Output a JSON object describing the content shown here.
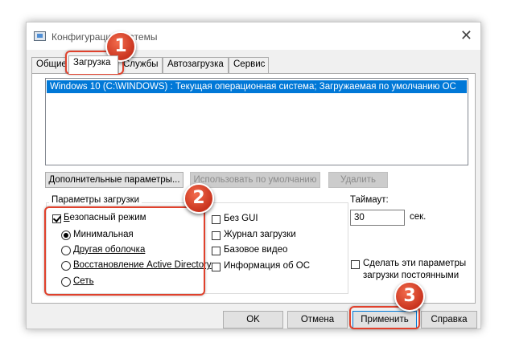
{
  "window": {
    "title": "Конфигурация системы",
    "close_symbol": "✕"
  },
  "tabs": [
    {
      "label": "Общие"
    },
    {
      "label": "Загрузка",
      "active": true
    },
    {
      "label": "Службы"
    },
    {
      "label": "Автозагрузка"
    },
    {
      "label": "Сервис"
    }
  ],
  "boot_list": {
    "items": [
      "Windows 10 (C:\\WINDOWS) : Текущая операционная система; Загружаемая по умолчанию ОС"
    ]
  },
  "buttons": {
    "advanced": "Дополнительные параметры...",
    "set_default": "Использовать по умолчанию",
    "delete": "Удалить"
  },
  "boot_options": {
    "group_title": "Параметры загрузки",
    "safe_boot": {
      "label": "Безопасный режим",
      "checked": true
    },
    "radios": [
      {
        "label": "Минимальная",
        "selected": true
      },
      {
        "label": "Другая оболочка",
        "selected": false
      },
      {
        "label": "Восстановление Active Directory",
        "selected": false
      },
      {
        "label": "Сеть",
        "selected": false
      }
    ],
    "right_checks": [
      {
        "label": "Без GUI",
        "checked": false
      },
      {
        "label": "Журнал загрузки",
        "checked": false
      },
      {
        "label": "Базовое видео",
        "checked": false
      },
      {
        "label": "Информация  об ОС",
        "checked": false
      }
    ]
  },
  "timeout": {
    "label": "Таймаут:",
    "value": "30",
    "unit": "сек."
  },
  "permanent": {
    "label_line1": "Сделать эти параметры",
    "label_line2": "загрузки постоянными",
    "checked": false
  },
  "dialog_buttons": {
    "ok": "OK",
    "cancel": "Отмена",
    "apply": "Применить",
    "help": "Справка"
  },
  "callouts": [
    "1",
    "2",
    "3"
  ],
  "colors": {
    "selection": "#0078d7",
    "callout": "#e0412c"
  }
}
